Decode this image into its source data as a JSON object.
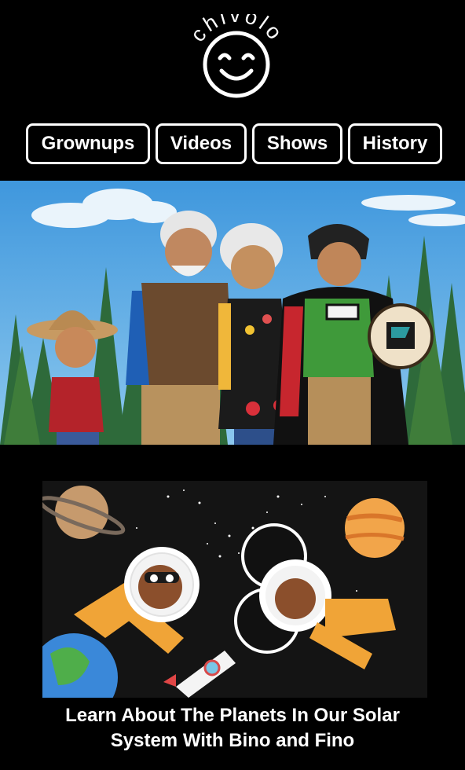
{
  "brand": {
    "name": "chivolo",
    "logo_icon": "smiley-face-icon"
  },
  "nav": {
    "items": [
      {
        "label": "Grownups"
      },
      {
        "label": "Videos"
      },
      {
        "label": "Shows"
      },
      {
        "label": "History"
      }
    ]
  },
  "hero": {
    "image": "hero-characters-forest-image"
  },
  "featured_video": {
    "thumbnail": "space-astronauts-thumbnail",
    "title": "Learn About The Planets In Our Solar System With Bino and Fino"
  },
  "colors": {
    "background": "#000000",
    "text": "#ffffff",
    "sky": "#4fa3e0",
    "space": "#141414"
  }
}
